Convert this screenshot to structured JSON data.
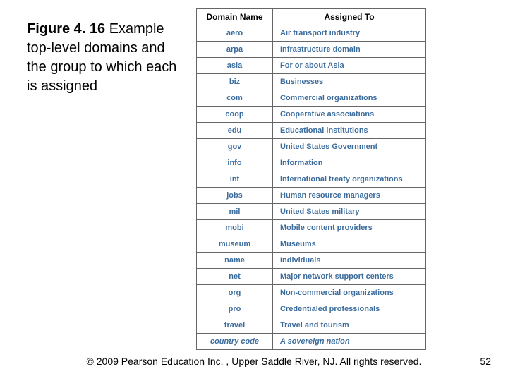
{
  "figure": {
    "label": "Figure 4. 16",
    "caption": "Example top-level domains and the group to which each is assigned"
  },
  "table": {
    "header": {
      "col1": "Domain Name",
      "col2": "Assigned To"
    },
    "rows": [
      {
        "domain": "aero",
        "assigned": "Air transport industry"
      },
      {
        "domain": "arpa",
        "assigned": "Infrastructure domain"
      },
      {
        "domain": "asia",
        "assigned": "For or about Asia"
      },
      {
        "domain": "biz",
        "assigned": "Businesses"
      },
      {
        "domain": "com",
        "assigned": "Commercial organizations"
      },
      {
        "domain": "coop",
        "assigned": "Cooperative associations"
      },
      {
        "domain": "edu",
        "assigned": "Educational institutions"
      },
      {
        "domain": "gov",
        "assigned": "United States Government"
      },
      {
        "domain": "info",
        "assigned": "Information"
      },
      {
        "domain": "int",
        "assigned": "International treaty organizations"
      },
      {
        "domain": "jobs",
        "assigned": "Human resource managers"
      },
      {
        "domain": "mil",
        "assigned": "United States military"
      },
      {
        "domain": "mobi",
        "assigned": "Mobile content providers"
      },
      {
        "domain": "museum",
        "assigned": "Museums"
      },
      {
        "domain": "name",
        "assigned": "Individuals"
      },
      {
        "domain": "net",
        "assigned": "Major network support centers"
      },
      {
        "domain": "org",
        "assigned": "Non-commercial organizations"
      },
      {
        "domain": "pro",
        "assigned": "Credentialed professionals"
      },
      {
        "domain": "travel",
        "assigned": "Travel and tourism"
      },
      {
        "domain": "country code",
        "assigned": "A sovereign nation",
        "italic": true
      }
    ]
  },
  "footer": {
    "copyright": "© 2009 Pearson Education Inc. , Upper Saddle River, NJ. All rights reserved.",
    "page": "52"
  }
}
